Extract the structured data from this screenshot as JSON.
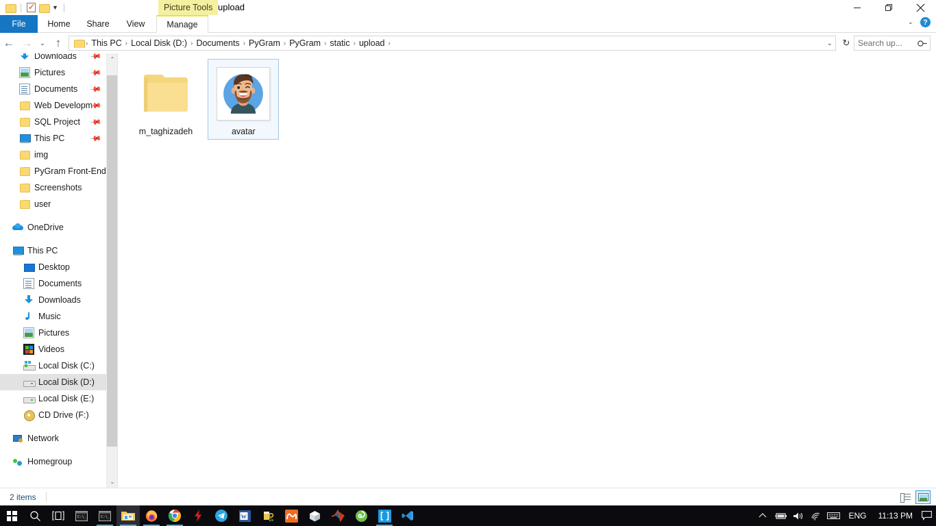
{
  "window": {
    "title": "upload",
    "contextual_tab": "Picture Tools",
    "quick_access": [
      {
        "name": "folder-icon",
        "label": "Folder"
      },
      {
        "name": "properties-icon",
        "label": "Properties"
      },
      {
        "name": "new-folder-icon",
        "label": "New folder"
      },
      {
        "name": "customize-qat-icon",
        "label": "Customize Quick Access Toolbar"
      }
    ],
    "controls": {
      "minimize": "—",
      "maximize": "❐",
      "close": "✕"
    },
    "ribbon_collapse": "⌄",
    "help": "?"
  },
  "ribbon": {
    "tabs": [
      {
        "label": "File",
        "selected": false,
        "kind": "file"
      },
      {
        "label": "Home",
        "selected": false,
        "kind": "normal"
      },
      {
        "label": "Share",
        "selected": false,
        "kind": "normal"
      },
      {
        "label": "View",
        "selected": false,
        "kind": "normal"
      },
      {
        "label": "Manage",
        "selected": true,
        "kind": "contextual"
      }
    ]
  },
  "address_bar": {
    "back": "←",
    "forward": "→",
    "recent": "⌄",
    "up": "↑",
    "breadcrumbs": [
      "This PC",
      "Local Disk (D:)",
      "Documents",
      "PyGram",
      "PyGram",
      "static",
      "upload"
    ],
    "separator": "›",
    "dropdown": "⌄",
    "refresh": "↻",
    "search_placeholder": "Search up...",
    "search_value": ""
  },
  "sidebar": {
    "quick_access": [
      {
        "label": "Downloads",
        "icon": "downloads-icon",
        "pinned": true
      },
      {
        "label": "Pictures",
        "icon": "pictures-icon",
        "pinned": true
      },
      {
        "label": "Documents",
        "icon": "documents-icon",
        "pinned": true
      },
      {
        "label": "Web Developme",
        "icon": "folder-icon",
        "pinned": true
      },
      {
        "label": "SQL Project",
        "icon": "folder-icon",
        "pinned": true
      },
      {
        "label": "This PC",
        "icon": "this-pc-icon",
        "pinned": true
      },
      {
        "label": "img",
        "icon": "folder-icon",
        "pinned": false
      },
      {
        "label": "PyGram Front-End",
        "icon": "folder-icon",
        "pinned": false
      },
      {
        "label": "Screenshots",
        "icon": "folder-icon",
        "pinned": false
      },
      {
        "label": "user",
        "icon": "folder-icon",
        "pinned": false
      }
    ],
    "onedrive": {
      "label": "OneDrive",
      "icon": "onedrive-icon"
    },
    "this_pc": {
      "label": "This PC",
      "icon": "this-pc-icon",
      "children": [
        {
          "label": "Desktop",
          "icon": "desktop-icon",
          "selected": false
        },
        {
          "label": "Documents",
          "icon": "documents-icon",
          "selected": false
        },
        {
          "label": "Downloads",
          "icon": "downloads-icon",
          "selected": false
        },
        {
          "label": "Music",
          "icon": "music-icon",
          "selected": false
        },
        {
          "label": "Pictures",
          "icon": "pictures-icon",
          "selected": false
        },
        {
          "label": "Videos",
          "icon": "videos-icon",
          "selected": false
        },
        {
          "label": "Local Disk (C:)",
          "icon": "system-drive-icon",
          "selected": false
        },
        {
          "label": "Local Disk (D:)",
          "icon": "drive-icon",
          "selected": true
        },
        {
          "label": "Local Disk (E:)",
          "icon": "drive-icon",
          "selected": false
        },
        {
          "label": "CD Drive (F:)",
          "icon": "cd-drive-icon",
          "selected": false
        }
      ]
    },
    "network": {
      "label": "Network",
      "icon": "network-icon"
    },
    "homegroup": {
      "label": "Homegroup",
      "icon": "homegroup-icon"
    },
    "scroll_up": "⌃",
    "scroll_down": "⌄"
  },
  "files": [
    {
      "name": "m_taghizadeh",
      "type": "folder",
      "selected": false
    },
    {
      "name": "avatar",
      "type": "image",
      "selected": true
    }
  ],
  "status_bar": {
    "item_count": "2 items",
    "views": [
      {
        "name": "details-view-button",
        "active": false
      },
      {
        "name": "large-icons-view-button",
        "active": true
      }
    ]
  },
  "taskbar": {
    "items": [
      {
        "name": "start-button",
        "icon": "windows-logo-icon",
        "running": false,
        "active": false
      },
      {
        "name": "search-button",
        "icon": "search-icon",
        "running": false,
        "active": false
      },
      {
        "name": "task-view-button",
        "icon": "task-view-icon",
        "running": false,
        "active": false
      },
      {
        "name": "command-prompt-1",
        "icon": "command-prompt-icon",
        "running": false,
        "active": false
      },
      {
        "name": "command-prompt-2",
        "icon": "command-prompt-icon",
        "running": true,
        "active": false
      },
      {
        "name": "file-explorer",
        "icon": "file-explorer-icon",
        "running": true,
        "active": true
      },
      {
        "name": "firefox",
        "icon": "firefox-icon",
        "running": false,
        "active": false
      },
      {
        "name": "chrome",
        "icon": "chrome-icon",
        "running": true,
        "active": false
      },
      {
        "name": "flash-app",
        "icon": "lightning-bolt-icon",
        "running": false,
        "active": false
      },
      {
        "name": "telegram",
        "icon": "telegram-icon",
        "running": false,
        "active": false
      },
      {
        "name": "word",
        "icon": "word-icon",
        "running": false,
        "active": false
      },
      {
        "name": "beer-app",
        "icon": "beer-mug-icon",
        "running": false,
        "active": false
      },
      {
        "name": "xampp",
        "icon": "xampp-icon",
        "running": false,
        "active": false
      },
      {
        "name": "virtualbox",
        "icon": "cube-icon",
        "running": false,
        "active": false
      },
      {
        "name": "matlab",
        "icon": "matlab-icon",
        "running": false,
        "active": false
      },
      {
        "name": "node",
        "icon": "node-icon",
        "running": false,
        "active": false
      },
      {
        "name": "brackets",
        "icon": "brackets-icon",
        "running": true,
        "active": false
      },
      {
        "name": "vs-code",
        "icon": "vscode-icon",
        "running": false,
        "active": false
      }
    ],
    "tray": {
      "show_hidden": "⌃",
      "battery": "battery-icon",
      "volume": "volume-icon",
      "network": "wifi-icon",
      "keyboard": "keyboard-icon",
      "language": "ENG",
      "clock": "11:13 PM",
      "notifications": "notification-icon"
    }
  },
  "colors": {
    "file_tab_blue": "#1577c4",
    "contextual_yellow": "#f5f0a0",
    "selection_blue": "#9fc7e8",
    "selection_fill": "#f2f8fd",
    "avatar_bg": "#5ba4e5",
    "taskbar": "#0b0b0f"
  }
}
